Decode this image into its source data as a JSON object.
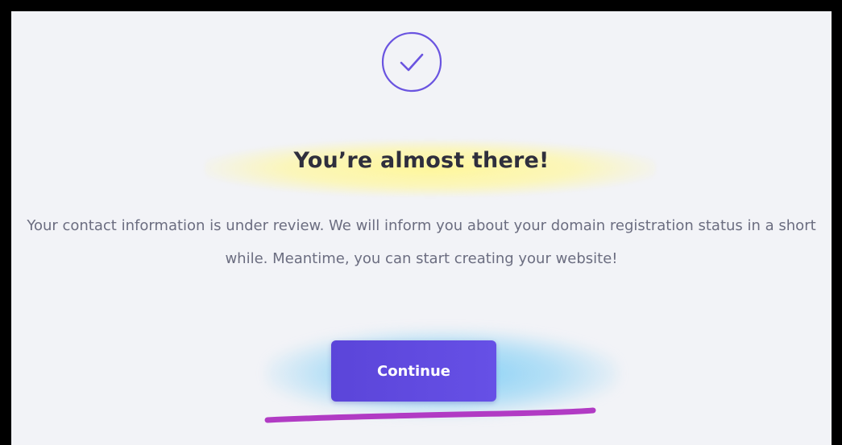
{
  "status_icon": {
    "name": "checkmark-circle-icon",
    "color": "#6a54e0"
  },
  "title": "You’re almost there!",
  "message": "Your contact information is under review. We will inform you about your domain registration status in a short while. Meantime, you can start creating your website!",
  "primary_button": {
    "label": "Continue",
    "color": "#5b45d9"
  },
  "annotations": {
    "title_highlight_color": "#fff79a",
    "button_highlight_color": "#7fcff3",
    "underline_color": "#b13bc4"
  }
}
